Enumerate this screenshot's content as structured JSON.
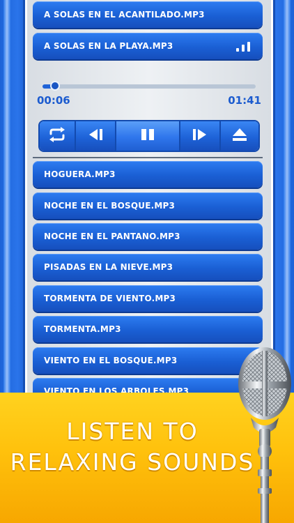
{
  "now_playing_list": [
    {
      "label": "A SOLAS EN EL ACANTILADO.MP3"
    },
    {
      "label": "A SOLAS EN LA PLAYA.MP3",
      "playing": true
    }
  ],
  "player": {
    "elapsed": "00:06",
    "duration": "01:41",
    "progress_fraction": 0.06
  },
  "controls": [
    {
      "name": "repeat-button",
      "icon": "repeat-icon"
    },
    {
      "name": "previous-button",
      "icon": "previous-icon"
    },
    {
      "name": "pause-button",
      "icon": "pause-icon"
    },
    {
      "name": "next-button",
      "icon": "next-icon"
    },
    {
      "name": "eject-button",
      "icon": "eject-icon"
    }
  ],
  "tracks": [
    {
      "label": "HOGUERA.MP3"
    },
    {
      "label": "NOCHE EN EL BOSQUE.MP3"
    },
    {
      "label": "NOCHE EN EL PANTANO.MP3"
    },
    {
      "label": "PISADAS EN LA NIEVE.MP3"
    },
    {
      "label": "TORMENTA DE VIENTO.MP3"
    },
    {
      "label": "TORMENTA.MP3"
    },
    {
      "label": "VIENTO EN EL BOSQUE.MP3"
    },
    {
      "label": "VIENTO EN LOS ARBOLES.MP3"
    }
  ],
  "promo": {
    "line1": "LISTEN TO",
    "line2": "RELAXING SOUNDS"
  },
  "colors": {
    "accent_blue": "#1f63d8",
    "banner_yellow": "#ffc10c"
  }
}
